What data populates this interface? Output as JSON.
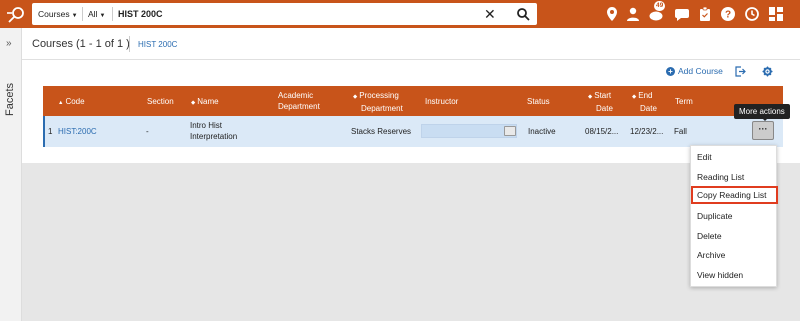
{
  "topbar": {
    "search_scope": "Courses",
    "search_filter": "All",
    "search_value": "HIST 200C",
    "notification_count": "49",
    "icons": [
      "location-icon",
      "user-icon",
      "notifications-icon",
      "chat-icon",
      "clipboard-icon",
      "help-icon",
      "history-icon",
      "apps-icon"
    ]
  },
  "facets": {
    "label": "Facets"
  },
  "header": {
    "title": "Courses (1 - 1 of 1 )",
    "breadcrumb": "HIST 200C"
  },
  "toolbar": {
    "add_course": "Add Course"
  },
  "table": {
    "columns": {
      "code": "Code",
      "section": "Section",
      "name": "Name",
      "academic_department_1": "Academic",
      "academic_department_2": "Department",
      "processing_department_1": "Processing",
      "processing_department_2": "Department",
      "instructor": "Instructor",
      "status": "Status",
      "start_date_1": "Start",
      "start_date_2": "Date",
      "end_date_1": "End",
      "end_date_2": "Date",
      "term": "Term"
    },
    "rows": [
      {
        "index": "1",
        "code": "HIST:200C",
        "section": "-",
        "name_1": "Intro Hist",
        "name_2": "Interpretation",
        "processing_department": "Stacks Reserves",
        "status": "Inactive",
        "start_date": "08/15/2...",
        "end_date": "12/23/2...",
        "term": "Fall"
      }
    ]
  },
  "more_actions": {
    "button_label": "···",
    "tooltip": "More actions",
    "menu": [
      "Edit",
      "Reading List",
      "Copy Reading List",
      "Duplicate",
      "Delete",
      "Archive",
      "View hidden"
    ],
    "highlighted_item": "Copy Reading List"
  },
  "colors": {
    "brand": "#c8541a",
    "link": "#2b6cb0",
    "row_selected": "#dbe9f7",
    "highlight_border": "#e03c1f"
  }
}
